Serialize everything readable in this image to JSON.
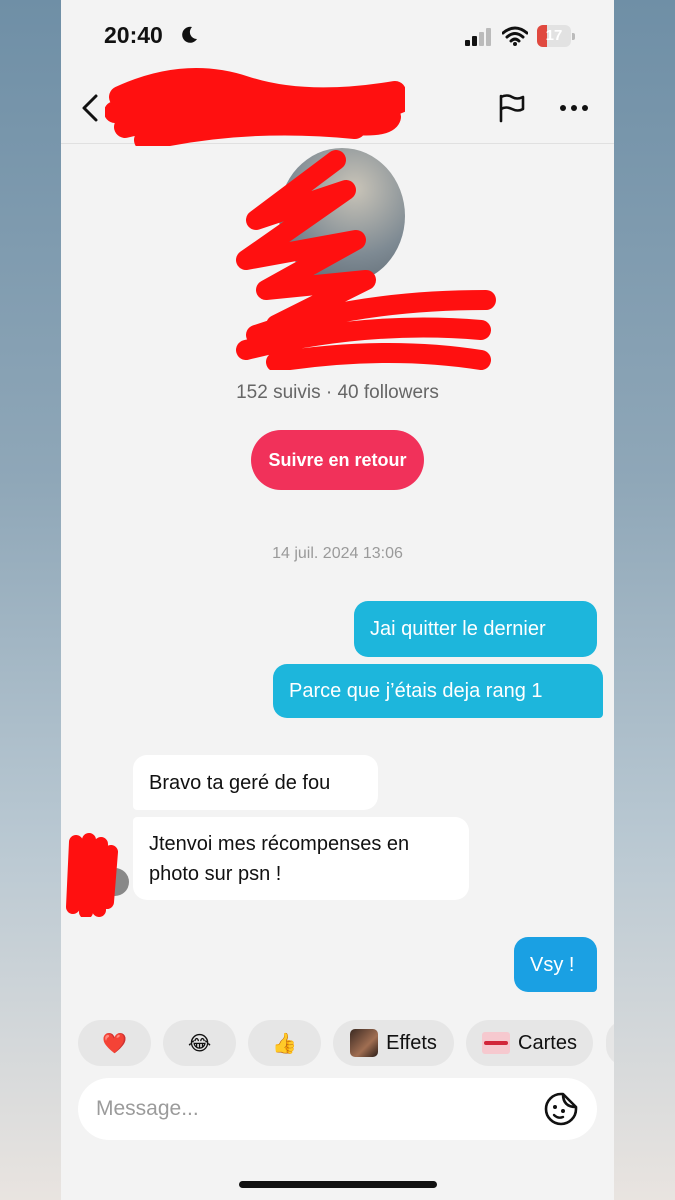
{
  "status_bar": {
    "time": "20:40",
    "battery": "17",
    "battery_level": 0.17
  },
  "header": {
    "title": "",
    "back": "back",
    "report": "report",
    "more": "more options"
  },
  "profile": {
    "stats": "152 suivis · 40 followers",
    "follow_back_label": "Suivre en retour"
  },
  "conversation": {
    "timestamp": "14 juil. 2024 13:06",
    "messages": [
      {
        "from": "me",
        "text": "Jai quitter le dernier"
      },
      {
        "from": "me",
        "text": "Parce que j’étais deja rang 1"
      },
      {
        "from": "them",
        "text": "Bravo ta geré de fou"
      },
      {
        "from": "them",
        "text": "Jtenvoi mes récompenses en photo sur psn !"
      },
      {
        "from": "me",
        "text": "Vsy !"
      }
    ]
  },
  "quick_replies": [
    {
      "icon": "red-heart-emoji",
      "glyph": "❤️"
    },
    {
      "icon": "tears-of-joy-emoji",
      "glyph": "😂"
    },
    {
      "icon": "thumbs-up-emoji",
      "glyph": "👍"
    },
    {
      "icon": "effects-thumbnail",
      "label": "Effets"
    },
    {
      "icon": "cards-thumbnail",
      "label": "Cartes"
    }
  ],
  "composer": {
    "placeholder": "Message..."
  },
  "colors": {
    "accent_pink": "#f1315a",
    "outgoing_bubble": "#1db6dc",
    "redaction": "#ff0000"
  }
}
